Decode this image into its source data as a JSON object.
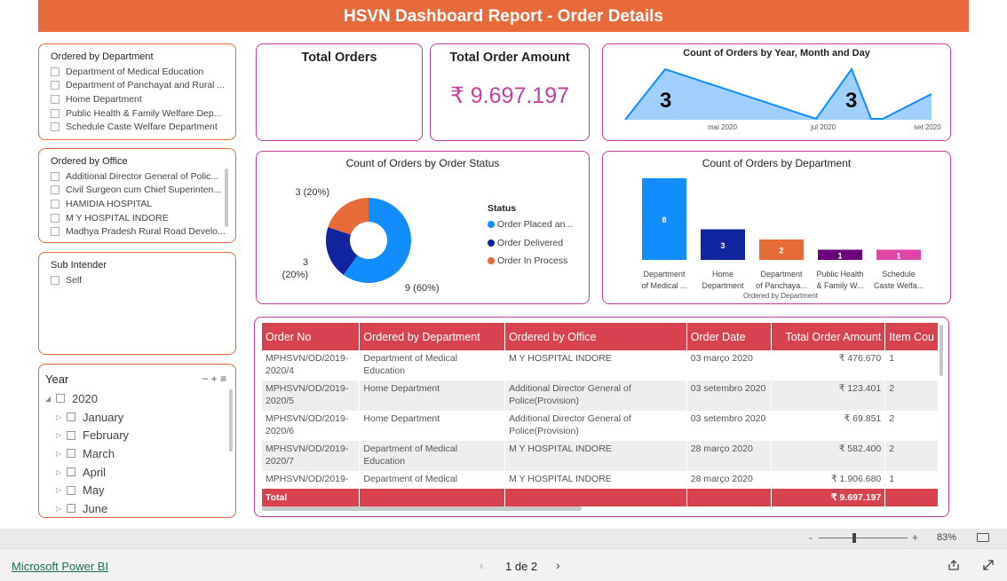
{
  "header": {
    "title": "HSVN Dashboard Report - Order Details"
  },
  "slicer_department": {
    "title": "Ordered by Department",
    "items": [
      "Department of Medical Education",
      "Department of Panchayat and Rural ...",
      "Home Department",
      "Public Health & Family Welfare Dep...",
      "Schedule Caste Welfare Department"
    ]
  },
  "slicer_office": {
    "title": "Ordered by Office",
    "items": [
      "Additional Director General of Polic...",
      "Civil Surgeon cum Chief Superinten...",
      "HAMIDIA HOSPITAL",
      "M Y HOSPITAL INDORE",
      "Madhya Pradesh Rural Road Develo..."
    ]
  },
  "slicer_sub": {
    "title": "Sub Intender",
    "items": [
      "Self"
    ]
  },
  "slicer_year": {
    "title": "Year",
    "controls": "− + ≡",
    "year": "2020",
    "months": [
      "January",
      "February",
      "March",
      "April",
      "May",
      "June"
    ]
  },
  "kpi_total_orders": {
    "title": "Total Orders",
    "value": ""
  },
  "kpi_total_amount": {
    "title": "Total Order Amount",
    "value": "₹ 9.697.197"
  },
  "area_chart": {
    "title": "Count of Orders by Year, Month and Day",
    "labels": [
      "mai 2020",
      "jul 2020",
      "set 2020"
    ],
    "peak_labels": [
      "3",
      "3"
    ],
    "color": "#118dff"
  },
  "donut_chart": {
    "title": "Count of Orders by Order Status",
    "legend_title": "Status",
    "slices": [
      {
        "name": "Order Placed an...",
        "value": 9,
        "label": "9 (60%)",
        "color": "#118dff"
      },
      {
        "name": "Order Delivered",
        "value": 3,
        "label": "3\n(20%)",
        "color": "#12239e"
      },
      {
        "name": "Order In Process",
        "value": 3,
        "label": "3 (20%)",
        "color": "#e66c37"
      }
    ]
  },
  "bar_chart": {
    "title": "Count of Orders by Department",
    "xlabel": "Ordered by Department",
    "bars": [
      {
        "label1": "Department",
        "label2": "of Medical ...",
        "value": 8,
        "color": "#118dff"
      },
      {
        "label1": "Home",
        "label2": "Department",
        "value": 3,
        "color": "#12239e"
      },
      {
        "label1": "Department",
        "label2": "of Panchaya...",
        "value": 2,
        "color": "#e66c37"
      },
      {
        "label1": "Public Health",
        "label2": "& Family W...",
        "value": 1,
        "color": "#6b007b"
      },
      {
        "label1": "Schedule",
        "label2": "Caste Welfa...",
        "value": 1,
        "color": "#e044a7"
      }
    ]
  },
  "chart_data": [
    {
      "type": "area",
      "title": "Count of Orders by Year, Month and Day",
      "x": [
        "mai 2020",
        "jul 2020",
        "set 2020"
      ],
      "peaks": [
        3,
        3
      ]
    },
    {
      "type": "pie",
      "title": "Count of Orders by Order Status",
      "categories": [
        "Order Placed an...",
        "Order Delivered",
        "Order In Process"
      ],
      "values": [
        9,
        3,
        3
      ]
    },
    {
      "type": "bar",
      "title": "Count of Orders by Department",
      "xlabel": "Ordered by Department",
      "categories": [
        "Department of Medical ...",
        "Home Department",
        "Department of Panchaya...",
        "Public Health & Family W...",
        "Schedule Caste Welfa..."
      ],
      "values": [
        8,
        3,
        2,
        1,
        1
      ]
    }
  ],
  "table": {
    "columns": [
      "Order No",
      "Ordered by Department",
      "Ordered by Office",
      "Order Date",
      "Total Order Amount",
      "Item Cou"
    ],
    "rows": [
      [
        "MPHSVN/OD/2019-\n2020/4",
        "Department of Medical\nEducation",
        "M Y HOSPITAL INDORE",
        "03 março 2020",
        "₹ 476.670",
        "1"
      ],
      [
        "MPHSVN/OD/2019-\n2020/5",
        "Home Department",
        "Additional Director General of\nPolice(Provision)",
        "03 setembro 2020",
        "₹ 123.401",
        "2"
      ],
      [
        "MPHSVN/OD/2019-\n2020/6",
        "Home Department",
        "Additional Director General of\nPolice(Provision)",
        "03 setembro 2020",
        "₹ 69.851",
        "2"
      ],
      [
        "MPHSVN/OD/2019-\n2020/7",
        "Department of Medical\nEducation",
        "M Y HOSPITAL INDORE",
        "28 março 2020",
        "₹ 582.400",
        "2"
      ],
      [
        "MPHSVN/OD/2019-",
        "Department of Medical",
        "M Y HOSPITAL INDORE",
        "28 março 2020",
        "₹ 1.906.680",
        "1"
      ]
    ],
    "total_label": "Total",
    "total_amount": "₹ 9.697.197"
  },
  "zoom": {
    "minus": "-",
    "plus": "+",
    "value": "83%"
  },
  "footer": {
    "brand": "Microsoft Power BI",
    "pager": "1 de 2"
  }
}
